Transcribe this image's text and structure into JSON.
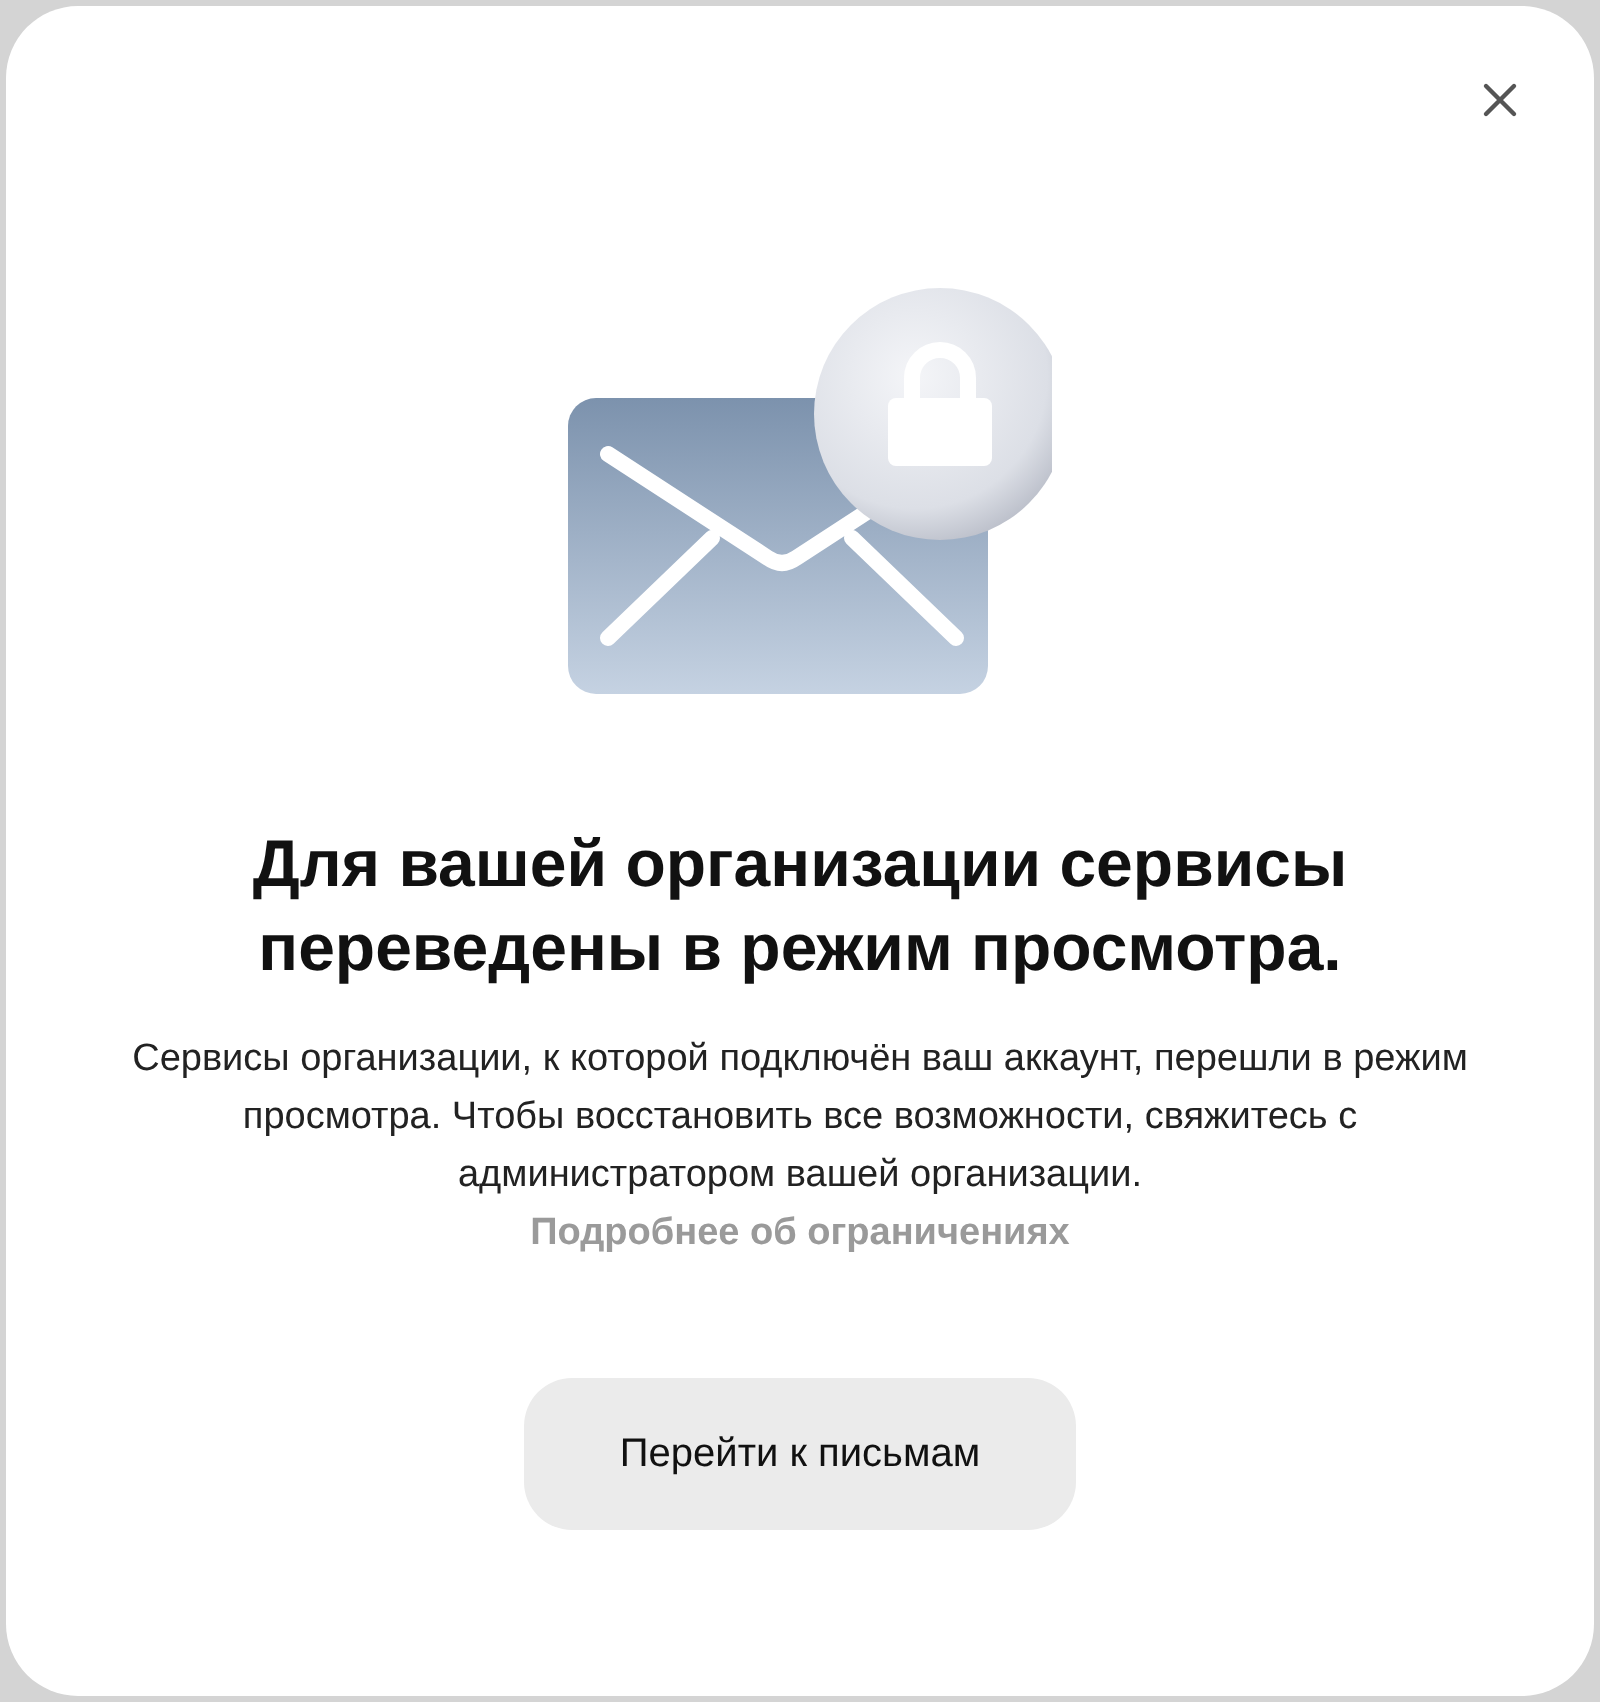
{
  "dialog": {
    "title": "Для вашей организации сервисы переведены в режим просмотра.",
    "description": "Сервисы организации, к которой подключён ваш аккаунт, перешли в режим просмотра. Чтобы восстановить все возможности, свяжитесь с администратором вашей организации.",
    "link": "Подробнее об ограничениях",
    "button": "Перейти к письмам"
  }
}
